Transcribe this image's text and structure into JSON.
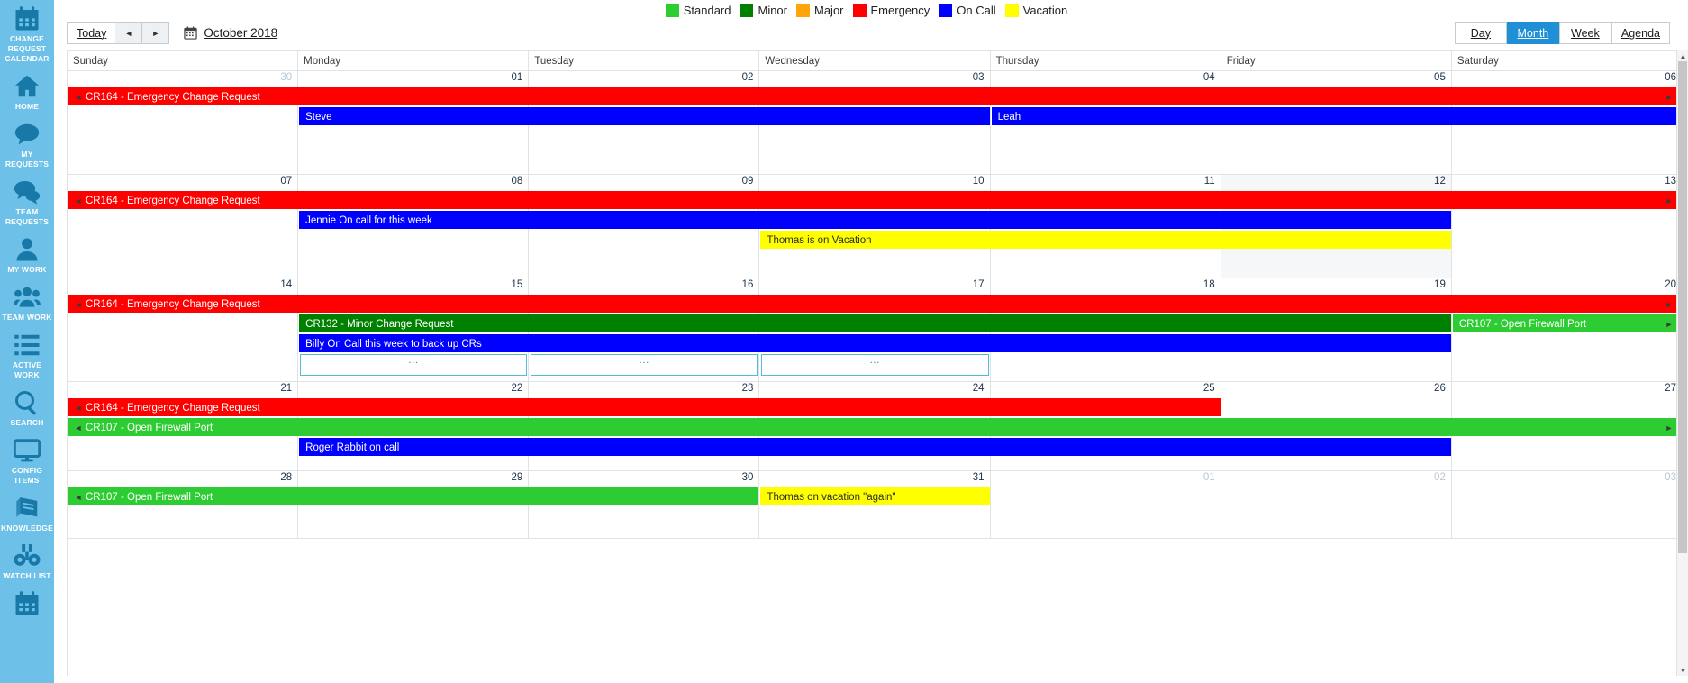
{
  "sidebar": {
    "items": [
      {
        "label": "CHANGE\nREQUEST\nCALENDAR",
        "icon": "calendar-icon",
        "active": true
      },
      {
        "label": "HOME",
        "icon": "home-icon"
      },
      {
        "label": "MY REQUESTS",
        "icon": "speech-bubble-icon"
      },
      {
        "label": "TEAM\nREQUESTS",
        "icon": "speech-bubbles-icon"
      },
      {
        "label": "MY WORK",
        "icon": "person-icon"
      },
      {
        "label": "TEAM WORK",
        "icon": "people-icon"
      },
      {
        "label": "ACTIVE WORK",
        "icon": "list-icon"
      },
      {
        "label": "SEARCH",
        "icon": "search-icon"
      },
      {
        "label": "CONFIG\nITEMS",
        "icon": "monitor-icon"
      },
      {
        "label": "KNOWLEDGE",
        "icon": "book-icon"
      },
      {
        "label": "WATCH LIST",
        "icon": "binoculars-icon"
      },
      {
        "label": "",
        "icon": "calendar-icon"
      }
    ],
    "background_color": "#6dc1e8",
    "icon_color": "#1878a8"
  },
  "legend": {
    "items": [
      {
        "label": "Standard",
        "color": "#2ecc33"
      },
      {
        "label": "Minor",
        "color": "#008000"
      },
      {
        "label": "Major",
        "color": "#ffa50a"
      },
      {
        "label": "Emergency",
        "color": "#ff0000"
      },
      {
        "label": "On Call",
        "color": "#0000ff"
      },
      {
        "label": "Vacation",
        "color": "#ffff00"
      }
    ]
  },
  "toolbar": {
    "today_label": "Today",
    "prev_label": "◄",
    "next_label": "►",
    "calendar_icon": "calendar-icon",
    "current_period": "October 2018",
    "views": [
      {
        "label": "Day",
        "active": false
      },
      {
        "label": "Month",
        "active": true
      },
      {
        "label": "Week",
        "active": false
      },
      {
        "label": "Agenda",
        "active": false
      }
    ],
    "active_view_color": "#1f8fd6"
  },
  "calendar": {
    "day_headers": [
      "Sunday",
      "Monday",
      "Tuesday",
      "Wednesday",
      "Thursday",
      "Friday",
      "Saturday"
    ],
    "weeks": [
      {
        "days": [
          {
            "num": "30",
            "other_month": true
          },
          {
            "num": "01"
          },
          {
            "num": "02"
          },
          {
            "num": "03"
          },
          {
            "num": "04"
          },
          {
            "num": "05"
          },
          {
            "num": "06"
          }
        ],
        "events": [
          {
            "title": "CR164 - Emergency Change Request",
            "color": "#ff0000",
            "text": "light",
            "start": 0,
            "span": 7,
            "row": 0,
            "cont_left": true,
            "cont_right": true
          },
          {
            "title": "Steve",
            "color": "#0000ff",
            "text": "light",
            "start": 1,
            "span": 3,
            "row": 1
          },
          {
            "title": "Leah",
            "color": "#0000ff",
            "text": "light",
            "start": 4,
            "span": 3,
            "row": 1
          }
        ]
      },
      {
        "days": [
          {
            "num": "07"
          },
          {
            "num": "08"
          },
          {
            "num": "09"
          },
          {
            "num": "10"
          },
          {
            "num": "11"
          },
          {
            "num": "12",
            "today": true
          },
          {
            "num": "13"
          }
        ],
        "events": [
          {
            "title": "CR164 - Emergency Change Request",
            "color": "#ff0000",
            "text": "light",
            "start": 0,
            "span": 7,
            "row": 0,
            "cont_left": true,
            "cont_right": true
          },
          {
            "title": "Jennie On call for this week",
            "color": "#0000ff",
            "text": "light",
            "start": 1,
            "span": 5,
            "row": 1
          },
          {
            "title": "Thomas is on Vacation",
            "color": "#ffff00",
            "text": "dark",
            "start": 3,
            "span": 3,
            "row": 2
          }
        ]
      },
      {
        "days": [
          {
            "num": "14"
          },
          {
            "num": "15"
          },
          {
            "num": "16"
          },
          {
            "num": "17"
          },
          {
            "num": "18"
          },
          {
            "num": "19"
          },
          {
            "num": "20"
          }
        ],
        "events": [
          {
            "title": "CR164 - Emergency Change Request",
            "color": "#ff0000",
            "text": "light",
            "start": 0,
            "span": 7,
            "row": 0,
            "cont_left": true,
            "cont_right": true
          },
          {
            "title": "CR132 - Minor Change Request",
            "color": "#008000",
            "text": "light",
            "start": 1,
            "span": 5,
            "row": 1
          },
          {
            "title": "CR107 - Open Firewall Port",
            "color": "#2ecc33",
            "text": "light",
            "start": 6,
            "span": 1,
            "row": 1,
            "cont_right": true
          },
          {
            "title": "Billy On Call this week to back up CRs",
            "color": "#0000ff",
            "text": "light",
            "start": 1,
            "span": 5,
            "row": 2
          }
        ],
        "more_cells": [
          {
            "start": 1,
            "label": "…"
          },
          {
            "start": 2,
            "label": "…"
          },
          {
            "start": 3,
            "label": "…"
          }
        ]
      },
      {
        "days": [
          {
            "num": "21"
          },
          {
            "num": "22"
          },
          {
            "num": "23"
          },
          {
            "num": "24"
          },
          {
            "num": "25"
          },
          {
            "num": "26"
          },
          {
            "num": "27"
          }
        ],
        "events": [
          {
            "title": "CR164 - Emergency Change Request",
            "color": "#ff0000",
            "text": "light",
            "start": 0,
            "span": 5,
            "row": 0,
            "cont_left": true
          },
          {
            "title": "CR107 - Open Firewall Port",
            "color": "#2ecc33",
            "text": "light",
            "start": 0,
            "span": 7,
            "row": 1,
            "cont_left": true,
            "cont_right": true
          },
          {
            "title": "Roger Rabbit on call",
            "color": "#0000ff",
            "text": "light",
            "start": 1,
            "span": 5,
            "row": 2
          }
        ]
      },
      {
        "days": [
          {
            "num": "28"
          },
          {
            "num": "29"
          },
          {
            "num": "30"
          },
          {
            "num": "31"
          },
          {
            "num": "01",
            "other_month": true
          },
          {
            "num": "02",
            "other_month": true
          },
          {
            "num": "03",
            "other_month": true
          }
        ],
        "events": [
          {
            "title": "CR107 - Open Firewall Port",
            "color": "#2ecc33",
            "text": "light",
            "start": 0,
            "span": 3,
            "row": 0,
            "cont_left": true
          },
          {
            "title": "Thomas on vacation \"again\"",
            "color": "#ffff00",
            "text": "dark",
            "start": 3,
            "span": 1,
            "row": 0
          }
        ]
      }
    ]
  },
  "scrollbar": {
    "up_arrow": "▲",
    "down_arrow": "▼"
  }
}
